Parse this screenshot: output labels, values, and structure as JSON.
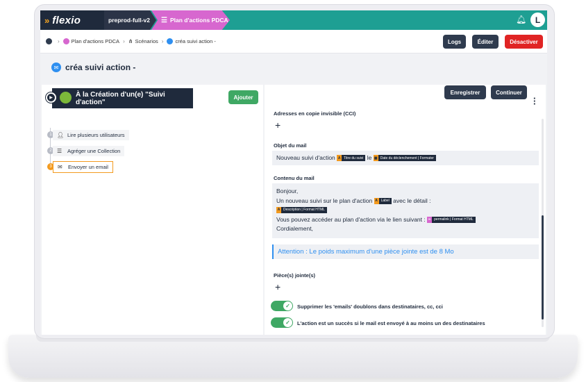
{
  "app": {
    "logo": "flexio",
    "environment": "preprod-full-v2",
    "module": "Plan d'actions PDCA",
    "user_initial": "L"
  },
  "breadcrumb": [
    "Plan d'actions PDCA",
    "Scénarios",
    "créa suivi action -"
  ],
  "toolbar": {
    "logs": "Logs",
    "edit": "Éditer",
    "deactivate": "Désactiver"
  },
  "page": {
    "title": "créa suivi action -"
  },
  "workflow": {
    "trigger": "À la Création d'un(e) \"Suivi d'action\"",
    "add_label": "Ajouter",
    "steps": [
      {
        "num": "1",
        "label": "Lire plusieurs utilisateurs",
        "icon": "user-icon"
      },
      {
        "num": "2",
        "label": "Agréger une Collection",
        "icon": "list-icon"
      },
      {
        "num": "3",
        "label": "Envoyer un email",
        "icon": "mail-icon"
      }
    ]
  },
  "form": {
    "save": "Enregistrer",
    "continue": "Continuer",
    "bcc_label": "Adresses en copie invisible (CCI)",
    "subject_label": "Objet du mail",
    "subject": {
      "text1": "Nouveau suivi d'action",
      "chip1": "Titre du suivi",
      "text2": "le",
      "chip2": "Date du déclenchement | Formater"
    },
    "body_label": "Contenu du mail",
    "body": {
      "line1": "Bonjour,",
      "line2a": "Un nouveau suivi sur le plan d'action",
      "chip_label": "Label",
      "line2b": "avec le détail :",
      "chip_desc": "Description | Format HTML",
      "line3": "Vous pouvez accéder au plan d'action via le lien suivant :",
      "chip_link": "permalink | Format HTML",
      "line4": "Cordialement,"
    },
    "attention": "Attention : Le poids maximum d'une pièce jointe est de 8 Mo",
    "attachments_label": "Pièce(s) jointe(s)",
    "toggle1": "Supprimer les 'emails' doublons dans destinataires, cc, cci",
    "toggle2": "L'action est un succès si le mail est envoyé à au moins un des destinataires"
  }
}
